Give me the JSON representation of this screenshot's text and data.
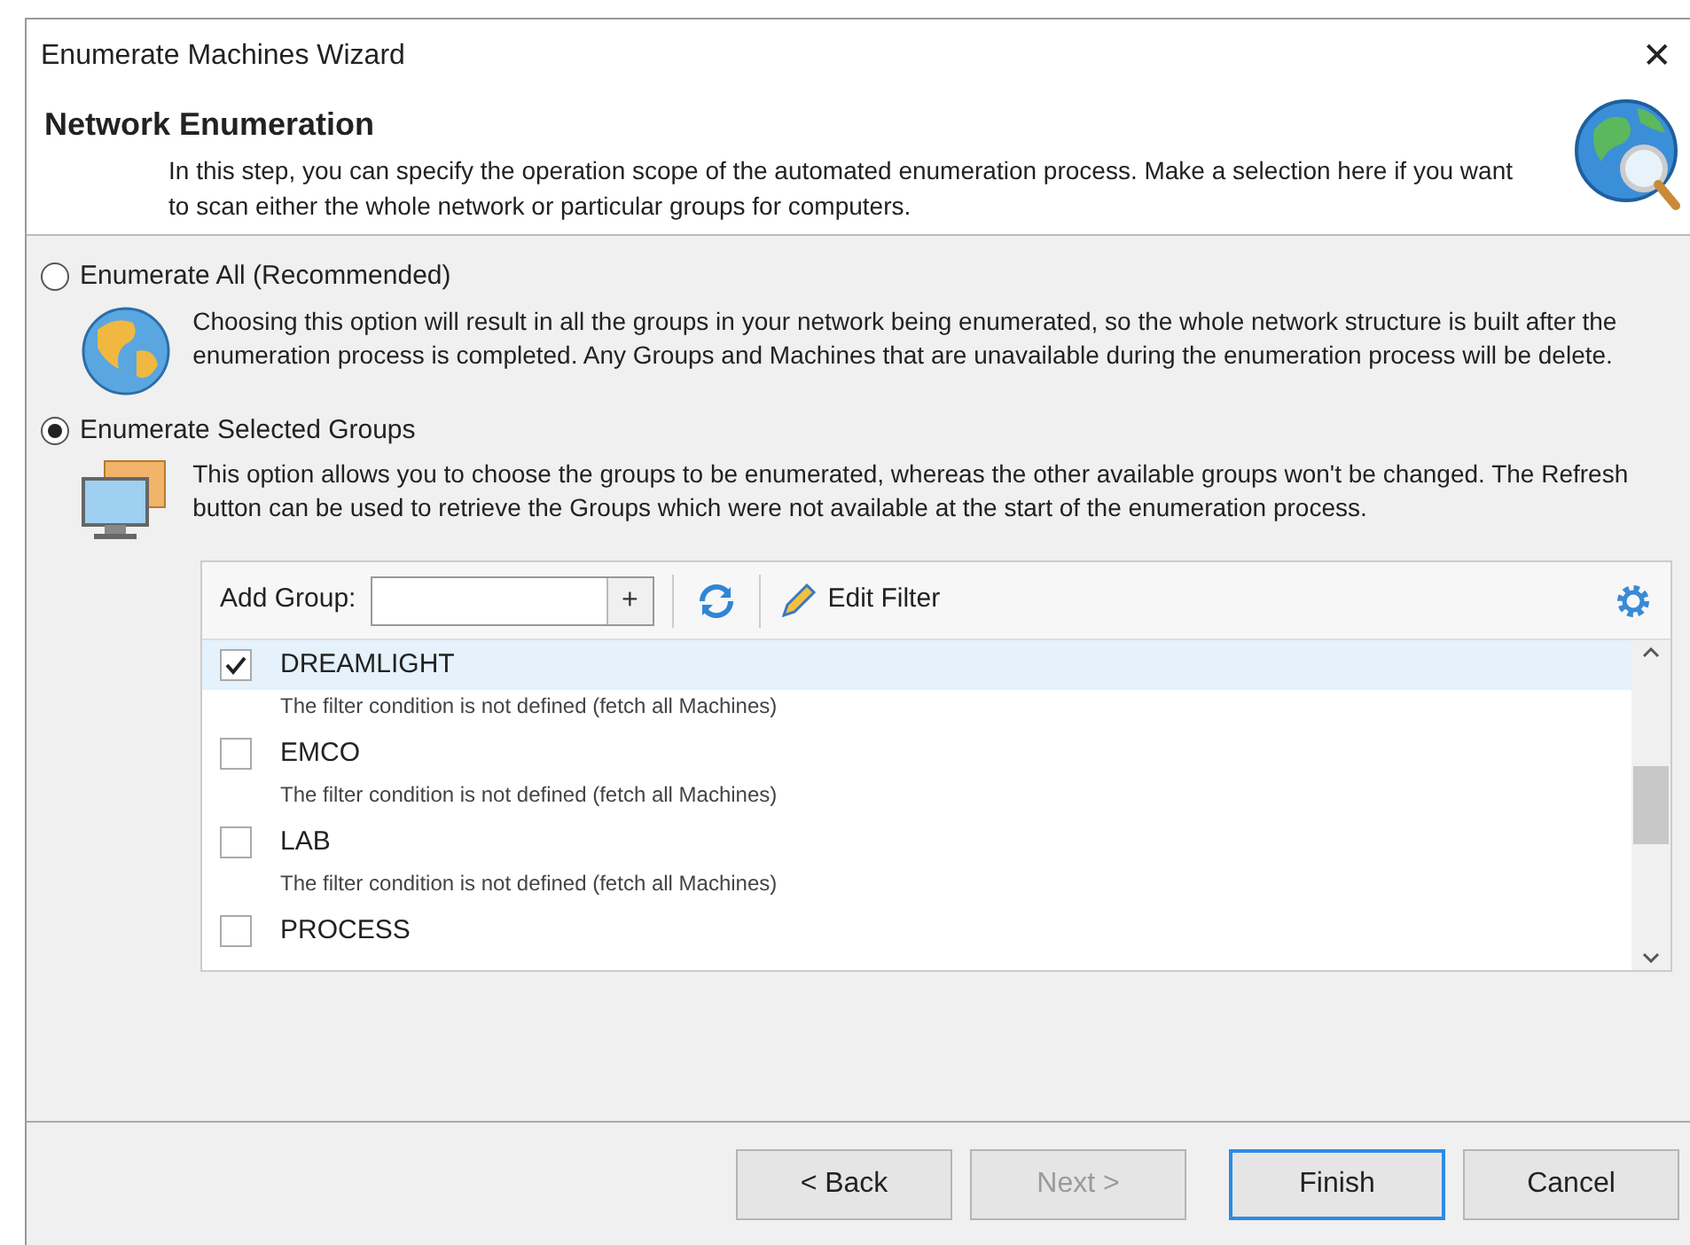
{
  "window": {
    "title": "Enumerate Machines Wizard",
    "close": "✕"
  },
  "header": {
    "title": "Network Enumeration",
    "description": "In this step, you can specify the operation scope of the automated enumeration process. Make a selection here if you want to scan either the whole network or particular groups for computers."
  },
  "options": [
    {
      "label": "Enumerate All (Recommended)",
      "selected": false,
      "kind": "globe",
      "description": "Choosing this option will result in all the groups in your network being enumerated, so the whole network structure is built after the enumeration process is completed. Any Groups and Machines that are unavailable during the enumeration process will be delete."
    },
    {
      "label": "Enumerate Selected Groups",
      "selected": true,
      "kind": "monitors",
      "description": "This option allows you to choose the groups to be enumerated, whereas the other available groups won't be changed. The Refresh button can be used to retrieve the Groups which were not available at the start of the enumeration process."
    }
  ],
  "toolbar": {
    "add_group_label": "Add Group:",
    "add_button": "+",
    "edit_filter": "Edit Filter"
  },
  "groups": [
    {
      "name": "DREAMLIGHT",
      "filter": "The filter condition is not defined (fetch all Machines)",
      "checked": true,
      "selected": true
    },
    {
      "name": "EMCO",
      "filter": "The filter condition is not defined (fetch all Machines)",
      "checked": false,
      "selected": false
    },
    {
      "name": "LAB",
      "filter": "The filter condition is not defined (fetch all Machines)",
      "checked": false,
      "selected": false
    },
    {
      "name": "PROCESS",
      "checked": false,
      "selected": false
    }
  ],
  "buttons": [
    {
      "label": "< Back",
      "disabled": false,
      "default": false
    },
    {
      "label": "Next >",
      "disabled": true,
      "default": false
    },
    {
      "label": "Finish",
      "disabled": false,
      "default": true
    },
    {
      "label": "Cancel",
      "disabled": false,
      "default": false
    }
  ]
}
